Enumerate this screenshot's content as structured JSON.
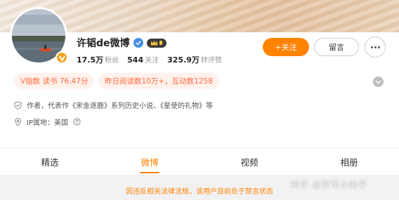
{
  "profile": {
    "name": "许韬de微博",
    "stats": [
      {
        "value": "17.5万",
        "label": "粉丝"
      },
      {
        "value": "544",
        "label": "关注"
      },
      {
        "value": "325.9万",
        "label": "转评赞"
      }
    ]
  },
  "actions": {
    "follow_label": "+关注",
    "message_label": "留言"
  },
  "tags": {
    "v_index": "V指数 读书 76.47分",
    "reads": "昨日阅读数10万+，互动数1258"
  },
  "info": {
    "author": "作者，代表作《宋金逐鹿》系列历史小说、《星使的礼物》等",
    "ip": "IP属地：美国"
  },
  "tabs": [
    {
      "label": "精选"
    },
    {
      "label": "微博"
    },
    {
      "label": "视频"
    },
    {
      "label": "相册"
    }
  ],
  "notice": "因违反相关法律法规，该用户目前处于禁言状态",
  "watermark": "知乎 @安可小助手",
  "colors": {
    "accent": "#ff8200",
    "tag_text": "#ff6a3d",
    "verify_blue": "#4a90e2"
  }
}
